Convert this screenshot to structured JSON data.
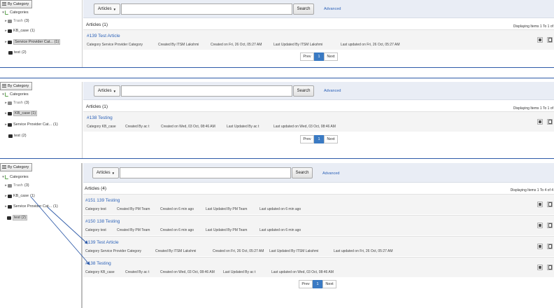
{
  "tree_header": "By Category",
  "categories_label": "Categories",
  "search": {
    "dropdown_label": "Articles",
    "button_label": "Search",
    "advanced_label": "Advanced",
    "input_value": ""
  },
  "pager": {
    "prev": "Prev",
    "page": "1",
    "next": "Next"
  },
  "panels": [
    {
      "tree": {
        "trash": "Trash",
        "trash_count": "(3)",
        "kb": "KB_case",
        "kb_count": "(1)",
        "sp": "Service Provider Cat...",
        "sp_count": "(1)",
        "test": "test",
        "test_count": "(2)"
      },
      "articles_title": "Articles (1)",
      "displaying": "Displaying Items 1 To 1 of",
      "articles": [
        {
          "title": "#139 Test Article",
          "category": "Category Service Provider Category",
          "created_by": "Created By ITSM Lakshmi",
          "created_on": "Created on Fri, 26 Oct, 05:27 AM",
          "updated_by": "Last Updated By ITSM Lakshmi",
          "updated_on": "Last updated on Fri, 26 Oct, 05:27 AM"
        }
      ]
    },
    {
      "tree": {
        "trash": "Trash",
        "trash_count": "(3)",
        "kb": "KB_case",
        "kb_count": "(1)",
        "sp": "Service Provider Cat...",
        "sp_count": "(1)",
        "test": "test",
        "test_count": "(2)"
      },
      "articles_title": "Articles (1)",
      "displaying": "Displaying Items 1 To 1 of",
      "articles": [
        {
          "title": "#138 Testing",
          "category": "Category KB_case",
          "created_by": "Created By ac t",
          "created_on": "Created on Wed, 03 Oct, 08:46 AM",
          "updated_by": "Last Updated By ac t",
          "updated_on": "Last updated on Wed, 03 Oct, 08:46 AM"
        }
      ]
    },
    {
      "tree": {
        "trash": "Trash",
        "trash_count": "(3)",
        "kb": "KB_case",
        "kb_count": "(1)",
        "sp": "Service Provider Cat...",
        "sp_count": "(1)",
        "test": "test",
        "test_count": "(2)"
      },
      "articles_title": "Articles (4)",
      "displaying": "Displaying Items 1 To 4 of 4",
      "articles": [
        {
          "title": "#151 139 Testing",
          "category": "Category test",
          "created_by": "Created By PM Team",
          "created_on": "Created on 6 min ago",
          "updated_by": "Last Updated By PM Team",
          "updated_on": "Last updated on 6 min ago"
        },
        {
          "title": "#150 138 Testing",
          "category": "Category test",
          "created_by": "Created By PM Team",
          "created_on": "Created on 6 min ago",
          "updated_by": "Last Updated By PM Team",
          "updated_on": "Last updated on 6 min ago"
        },
        {
          "title": "#139 Test Article",
          "category": "Category Service Provider Category",
          "created_by": "Created By ITSM Lakshmi",
          "created_on": "Created on Fri, 26 Oct, 05:27 AM",
          "updated_by": "Last Updated By ITSM Lakshmi",
          "updated_on": "Last updated on Fri, 26 Oct, 05:27 AM"
        },
        {
          "title": "#138 Testing",
          "category": "Category KB_case",
          "created_by": "Created By ac t",
          "created_on": "Created on Wed, 03 Oct, 08:46 AM",
          "updated_by": "Last Updated By ac t",
          "updated_on": "Last updated on Wed, 03 Oct, 08:46 AM"
        }
      ]
    }
  ],
  "colors": {
    "accent": "#2d62b8",
    "page_active": "#3a7ac3",
    "separator": "#2e5aa8"
  },
  "icons": [
    "list-icon",
    "folder-icon",
    "trash-folder-icon",
    "edit-icon",
    "delete-icon",
    "caret-down-icon",
    "expand-arrow-icon",
    "collapse-arrow-icon"
  ]
}
